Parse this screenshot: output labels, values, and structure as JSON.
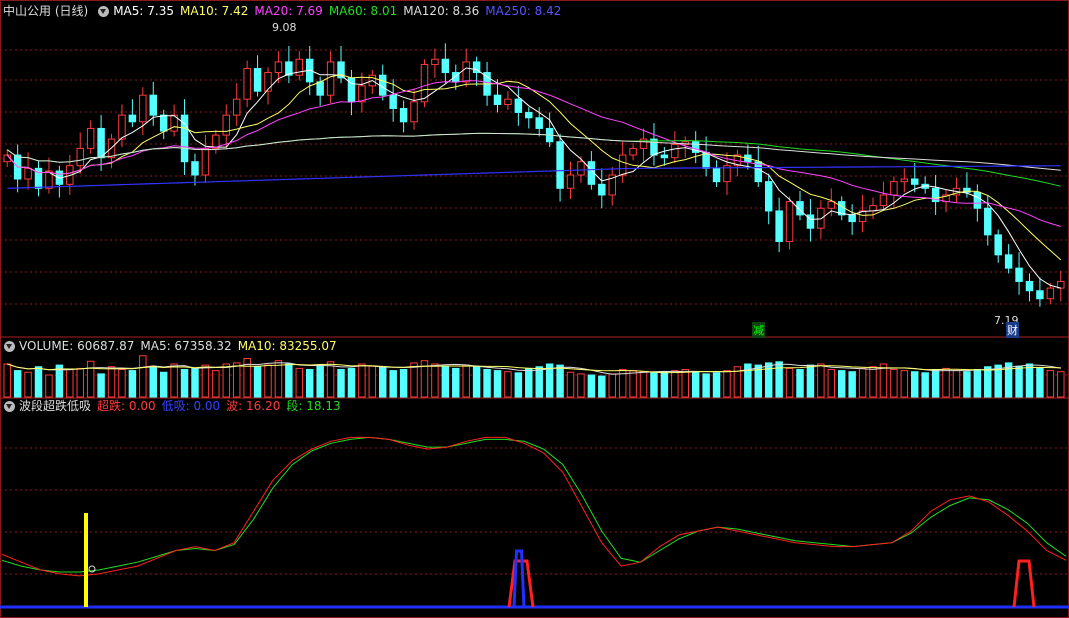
{
  "colors": {
    "bg": "#000000",
    "up": "#ff3b3b",
    "down": "#54ffff",
    "ma5": "#ffffff",
    "ma10": "#ffff66",
    "ma20": "#ff44ff",
    "ma60": "#22dd22",
    "ma120": "#dddddd",
    "ma250": "#3333ff",
    "grid": "#8a1a1a",
    "kdj_red": "#ff2020",
    "kdj_green": "#22dd22",
    "signal_blue": "#2030ff",
    "signal_yellow": "#ffff00"
  },
  "price_panel": {
    "title": "中山公用 (日线)",
    "indicators": [
      {
        "label": "MA5: 7.35",
        "color": "#ffffff"
      },
      {
        "label": "MA10: 7.42",
        "color": "#ffff66"
      },
      {
        "label": "MA20: 7.69",
        "color": "#ff44ff"
      },
      {
        "label": "MA60: 8.01",
        "color": "#22dd22"
      },
      {
        "label": "MA120: 8.36",
        "color": "#dddddd"
      },
      {
        "label": "MA250: 8.42",
        "color": "#5555ff"
      }
    ],
    "high_label": "9.08",
    "low_label": "7.19",
    "tag_a": "减",
    "tag_b": "财"
  },
  "volume_panel": {
    "indicators": [
      {
        "label": "VOLUME: 60687.87",
        "color": "#dddddd"
      },
      {
        "label": "MA5: 67358.32",
        "color": "#dddddd"
      },
      {
        "label": "MA10: 83255.07",
        "color": "#ffff66"
      }
    ]
  },
  "osc_panel": {
    "indicators": [
      {
        "label": "波段超跌低吸",
        "color": "#dddddd"
      },
      {
        "label": "超跌: 0.00",
        "color": "#ff3b3b"
      },
      {
        "label": "低吸: 0.00",
        "color": "#3344ff"
      },
      {
        "label": "波: 16.20",
        "color": "#ff3b3b"
      },
      {
        "label": "段: 18.13",
        "color": "#22dd22"
      }
    ]
  },
  "chart_data": {
    "type": "candlestick",
    "title": "中山公用 (日线)",
    "price_range": [
      7.0,
      9.3
    ],
    "ma_latest": {
      "MA5": 7.35,
      "MA10": 7.42,
      "MA20": 7.69,
      "MA60": 8.01,
      "MA120": 8.36,
      "MA250": 8.42
    },
    "marked_high": 9.08,
    "marked_low": 7.19,
    "closes": [
      8.3,
      8.12,
      8.2,
      8.05,
      8.18,
      8.08,
      8.22,
      8.35,
      8.5,
      8.28,
      8.42,
      8.6,
      8.55,
      8.75,
      8.6,
      8.48,
      8.6,
      8.25,
      8.15,
      8.35,
      8.45,
      8.6,
      8.72,
      8.95,
      8.78,
      8.92,
      9.0,
      8.9,
      9.02,
      8.85,
      8.75,
      9.0,
      8.88,
      8.7,
      8.82,
      8.9,
      8.75,
      8.65,
      8.55,
      8.7,
      8.98,
      9.02,
      8.92,
      8.85,
      9.0,
      8.92,
      8.75,
      8.68,
      8.72,
      8.62,
      8.58,
      8.5,
      8.4,
      8.05,
      8.15,
      8.25,
      8.08,
      8.0,
      8.15,
      8.3,
      8.35,
      8.42,
      8.3,
      8.28,
      8.38,
      8.4,
      8.32,
      8.2,
      8.1,
      8.22,
      8.3,
      8.25,
      8.1,
      7.88,
      7.65,
      7.95,
      7.85,
      7.75,
      7.9,
      7.95,
      7.85,
      7.8,
      7.88,
      7.92,
      8.0,
      8.1,
      8.12,
      8.08,
      8.05,
      7.95,
      8.0,
      8.05,
      8.02,
      7.9,
      7.7,
      7.55,
      7.45,
      7.35,
      7.28,
      7.22,
      7.3,
      7.35
    ],
    "volume": [
      60,
      48,
      45,
      55,
      40,
      58,
      50,
      52,
      65,
      42,
      55,
      50,
      48,
      75,
      55,
      45,
      60,
      50,
      52,
      58,
      48,
      60,
      62,
      70,
      55,
      58,
      66,
      60,
      52,
      50,
      58,
      64,
      50,
      52,
      60,
      56,
      54,
      48,
      50,
      62,
      66,
      60,
      56,
      52,
      58,
      55,
      50,
      48,
      46,
      44,
      52,
      55,
      60,
      58,
      45,
      42,
      40,
      38,
      42,
      50,
      48,
      46,
      44,
      45,
      48,
      50,
      46,
      42,
      44,
      48,
      55,
      60,
      58,
      62,
      64,
      52,
      50,
      58,
      60,
      50,
      48,
      46,
      52,
      55,
      60,
      50,
      48,
      46,
      44,
      50,
      52,
      48,
      46,
      50,
      55,
      58,
      62,
      56,
      60,
      52,
      48,
      46
    ],
    "vol_ma5_latest": 67358.32,
    "vol_ma10_latest": 83255.07,
    "volume_latest": 60687.87,
    "osc_red": [
      28,
      24,
      20,
      18,
      17,
      18,
      20,
      22,
      26,
      30,
      32,
      30,
      34,
      50,
      66,
      76,
      82,
      86,
      88,
      88,
      87,
      84,
      82,
      83,
      86,
      88,
      88,
      85,
      80,
      70,
      52,
      34,
      22,
      24,
      32,
      38,
      40,
      42,
      40,
      38,
      36,
      34,
      33,
      32,
      32,
      33,
      34,
      40,
      50,
      56,
      58,
      55,
      48,
      40,
      30,
      25
    ],
    "osc_green": [
      25,
      22,
      20,
      19,
      19,
      20,
      22,
      24,
      27,
      30,
      31,
      30,
      33,
      46,
      62,
      74,
      81,
      85,
      87,
      88,
      87,
      85,
      83,
      83,
      85,
      87,
      87,
      86,
      82,
      74,
      58,
      40,
      26,
      24,
      30,
      36,
      40,
      42,
      41,
      39,
      37,
      35,
      34,
      33,
      32,
      33,
      34,
      39,
      47,
      53,
      57,
      56,
      51,
      44,
      34,
      27
    ],
    "osc_range": [
      0,
      100
    ],
    "values_shown": {
      "超跌": 0.0,
      "低吸": 0.0,
      "波": 16.2,
      "段": 18.13
    }
  }
}
